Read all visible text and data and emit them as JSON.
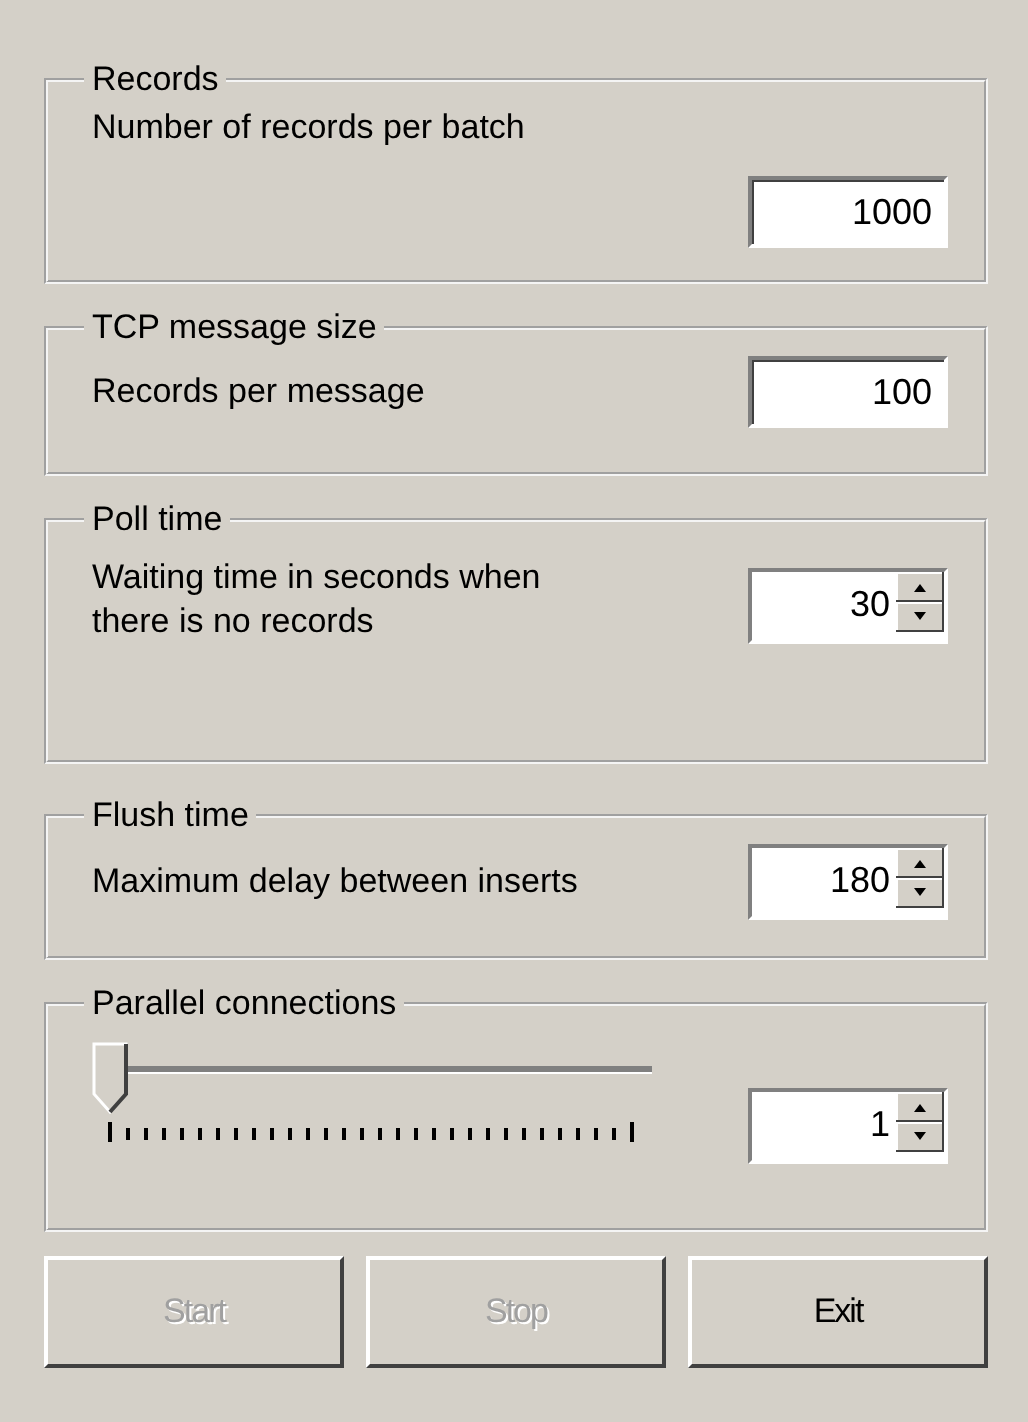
{
  "groups": [
    {
      "title": "Records",
      "kind": "text",
      "label": "Number of records per batch",
      "value": "1000"
    },
    {
      "title": "TCP message size",
      "kind": "text",
      "label": "Records per message",
      "value": "100"
    },
    {
      "title": "Poll time",
      "kind": "spin",
      "label": "Waiting time in seconds when there is no records",
      "value": "30"
    },
    {
      "title": "Flush time",
      "kind": "spin",
      "label": "Maximum delay between inserts",
      "value": "180"
    },
    {
      "title": "Parallel connections",
      "kind": "slider",
      "level": 0,
      "value": "1"
    }
  ],
  "buttons": [
    {
      "label": "Start",
      "disabled": true
    },
    {
      "label": "Stop",
      "disabled": true
    },
    {
      "label": "Exit",
      "disabled": false
    }
  ]
}
